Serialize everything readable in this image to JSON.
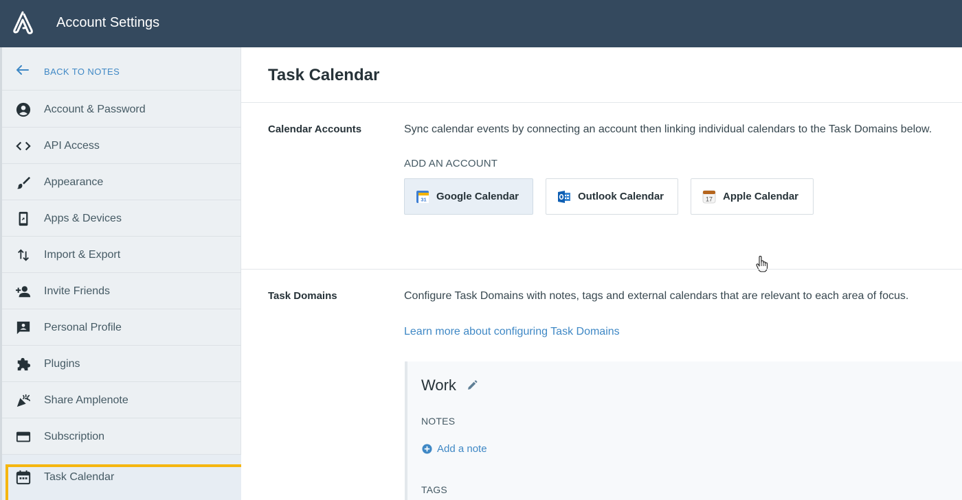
{
  "app": {
    "title": "Account Settings"
  },
  "sidebar": {
    "back_label": "BACK TO NOTES",
    "items": [
      {
        "label": "Account & Password",
        "icon": "account-circle-icon"
      },
      {
        "label": "API Access",
        "icon": "code-icon"
      },
      {
        "label": "Appearance",
        "icon": "brush-icon"
      },
      {
        "label": "Apps & Devices",
        "icon": "phone-device-icon"
      },
      {
        "label": "Import & Export",
        "icon": "import-export-icon"
      },
      {
        "label": "Invite Friends",
        "icon": "person-add-icon"
      },
      {
        "label": "Personal Profile",
        "icon": "profile-card-icon"
      },
      {
        "label": "Plugins",
        "icon": "puzzle-icon"
      },
      {
        "label": "Share Amplenote",
        "icon": "celebration-icon"
      },
      {
        "label": "Subscription",
        "icon": "credit-card-icon"
      },
      {
        "label": "Task Calendar",
        "icon": "calendar-icon",
        "active": true
      }
    ]
  },
  "main": {
    "title": "Task Calendar",
    "calendar_accounts": {
      "label": "Calendar Accounts",
      "description": "Sync calendar events by connecting an account then linking individual calendars to the Task Domains below.",
      "add_account_label": "ADD AN ACCOUNT",
      "providers": [
        {
          "label": "Google Calendar",
          "icon": "google-calendar-icon"
        },
        {
          "label": "Outlook Calendar",
          "icon": "outlook-calendar-icon"
        },
        {
          "label": "Apple Calendar",
          "icon": "apple-calendar-icon",
          "day": "17"
        }
      ]
    },
    "task_domains": {
      "label": "Task Domains",
      "description": "Configure Task Domains with notes, tags and external calendars that are relevant to each area of focus.",
      "learn_more": "Learn more about configuring Task Domains",
      "domain": {
        "name": "Work",
        "notes_label": "NOTES",
        "add_note_label": "Add a note",
        "tags_label": "TAGS"
      }
    }
  },
  "colors": {
    "header": "#34495e",
    "link": "#3f88c5",
    "highlight": "#f5b60f"
  }
}
